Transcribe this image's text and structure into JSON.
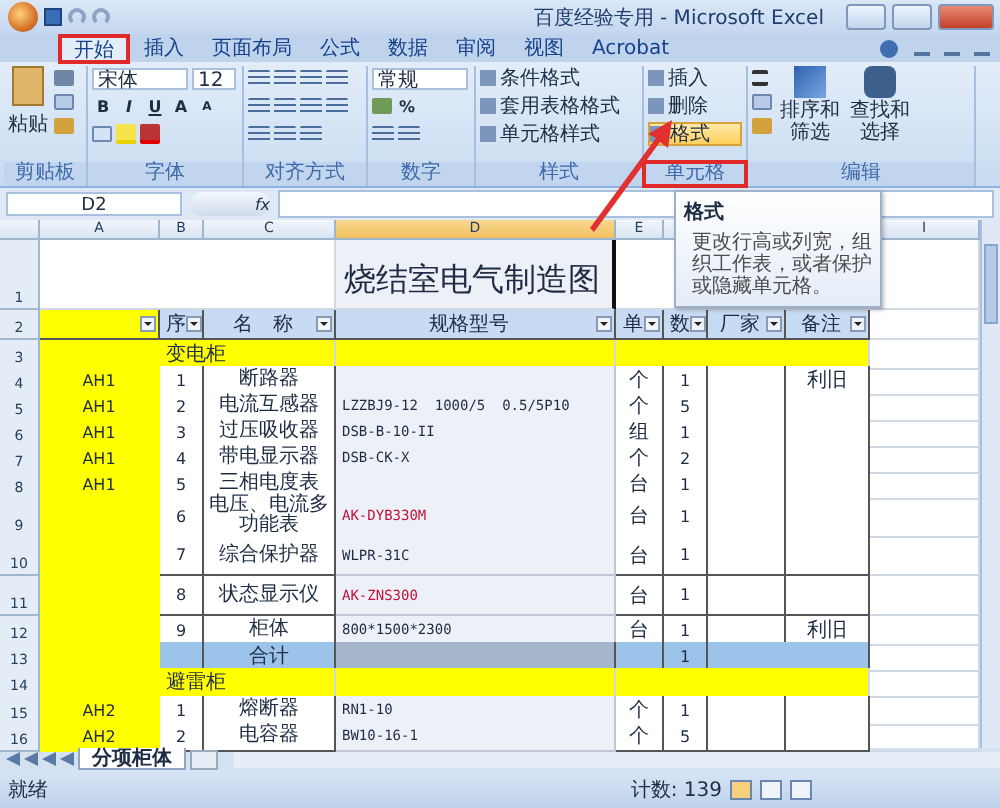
{
  "window": {
    "title": "百度经验专用 - Microsoft Excel"
  },
  "ribbon": {
    "tabs": [
      {
        "label": "开始",
        "selected": true,
        "marked": true
      },
      {
        "label": "插入",
        "selected": false,
        "marked": false
      },
      {
        "label": "页面布局",
        "selected": false,
        "marked": false
      },
      {
        "label": "公式",
        "selected": false,
        "marked": false
      },
      {
        "label": "数据",
        "selected": false,
        "marked": false
      },
      {
        "label": "审阅",
        "selected": false,
        "marked": false
      },
      {
        "label": "视图",
        "selected": false,
        "marked": false
      },
      {
        "label": "Acrobat",
        "selected": false,
        "marked": false
      }
    ],
    "clipboard": {
      "label": "剪贴板",
      "paste": "粘贴"
    },
    "font": {
      "label": "字体",
      "font_name": "宋体",
      "font_size": "12",
      "buttons": [
        "B",
        "I",
        "U",
        "A",
        "A"
      ]
    },
    "alignment": {
      "label": "对齐方式"
    },
    "number": {
      "label": "数字",
      "format": "常规",
      "percent": "%"
    },
    "styles": {
      "label": "样式",
      "commands": [
        "条件格式",
        "套用表格格式",
        "单元格样式"
      ]
    },
    "cells": {
      "label": "单元格",
      "marked": true,
      "commands": [
        {
          "label": "插入",
          "hovered": false
        },
        {
          "label": "删除",
          "hovered": false
        },
        {
          "label": "格式",
          "hovered": true
        }
      ]
    },
    "editing": {
      "label": "编辑",
      "sort": "排序和筛选",
      "find": "查找和选择"
    }
  },
  "tooltip": {
    "title": "格式",
    "text": "更改行高或列宽，组织工作表，或者保护或隐藏单元格。"
  },
  "formula_bar": {
    "name_box": "D2",
    "fx": "fx"
  },
  "sheet": {
    "columns": [
      "A",
      "B",
      "C",
      "D",
      "E",
      "I"
    ],
    "rows": [
      {
        "kind": "title",
        "number": "1",
        "d": "烧结室电气制造图"
      },
      {
        "kind": "header",
        "number": "2",
        "b": "序",
        "c": "名　称",
        "d": "规格型号",
        "e": "单",
        "f": "数",
        "g": "厂家",
        "h": "备注"
      },
      {
        "kind": "section",
        "number": "3",
        "b": "变电柜"
      },
      {
        "kind": "item",
        "number": "4",
        "a": "AH1",
        "b": "1",
        "c": "断路器",
        "e": "个",
        "f": "1",
        "h": "利旧"
      },
      {
        "kind": "item",
        "number": "5",
        "a": "AH1",
        "b": "2",
        "c": "电流互感器",
        "d": "LZZBJ9-12  1000/5  0.5/5P10",
        "e": "个",
        "f": "5",
        "d_highlighted": false
      },
      {
        "kind": "item",
        "number": "6",
        "a": "AH1",
        "b": "3",
        "c": "过压吸收器",
        "d": "DSB-B-10-II",
        "e": "组",
        "f": "1",
        "d_highlighted": false
      },
      {
        "kind": "item",
        "number": "7",
        "a": "AH1",
        "b": "4",
        "c": "带电显示器",
        "d": "DSB-CK-X",
        "e": "个",
        "f": "2",
        "d_highlighted": false
      },
      {
        "kind": "item",
        "number": "8",
        "a": "AH1",
        "b": "5",
        "c": "三相电度表",
        "e": "台",
        "f": "1"
      },
      {
        "kind": "item",
        "number": "9",
        "b": "6",
        "c": "电压、电流多功能表",
        "d": "AK-DYB330M",
        "e": "台",
        "f": "1",
        "d_highlighted": true
      },
      {
        "kind": "item",
        "number": "10",
        "b": "7",
        "c": "综合保护器",
        "d": "WLPR-31C",
        "e": "台",
        "f": "1",
        "d_highlighted": false
      },
      {
        "kind": "item",
        "number": "11",
        "b": "8",
        "c": "状态显示仪",
        "d": "AK-ZNS300",
        "e": "台",
        "f": "1",
        "d_highlighted": true
      },
      {
        "kind": "item",
        "number": "12",
        "b": "9",
        "c": "柜体",
        "d": "800*1500*2300",
        "e": "台",
        "f": "1",
        "h": "利旧",
        "d_highlighted": false
      },
      {
        "kind": "total",
        "number": "13",
        "c": "合计",
        "f": "1"
      },
      {
        "kind": "section",
        "number": "14",
        "b": "避雷柜"
      },
      {
        "kind": "item",
        "number": "15",
        "a": "AH2",
        "b": "1",
        "c": "熔断器",
        "d": "RN1-10",
        "e": "个",
        "f": "1",
        "d_highlighted": false
      },
      {
        "kind": "item",
        "number": "16",
        "a": "AH2",
        "b": "2",
        "c": "电容器",
        "d": "BW10-16-1",
        "e": "个",
        "f": "5",
        "d_highlighted": false
      }
    ]
  },
  "sheet_tabs": [
    {
      "label": "分项柜体",
      "selected": true
    }
  ],
  "status_bar": {
    "state": "就绪",
    "count": "计数: 139"
  }
}
